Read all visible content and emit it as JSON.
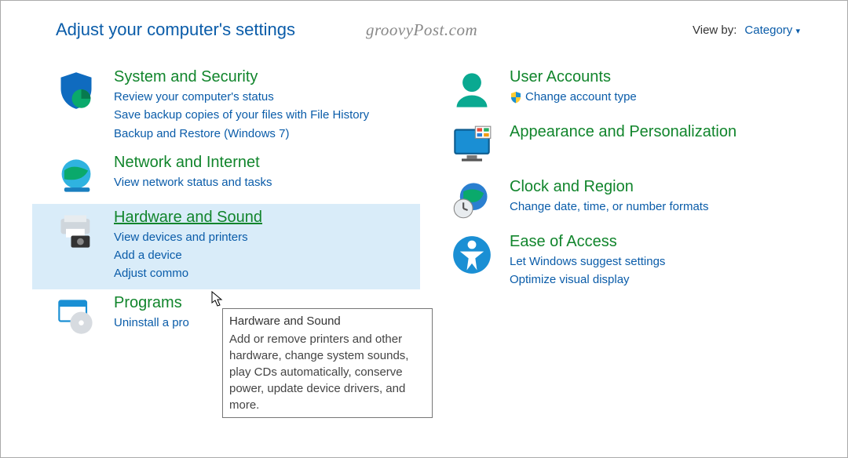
{
  "header": {
    "title": "Adjust your computer's settings",
    "watermark": "groovyPost.com",
    "view_by_label": "View by:",
    "view_by_value": "Category"
  },
  "left": [
    {
      "id": "system-security",
      "title": "System and Security",
      "links": [
        "Review your computer's status",
        "Save backup copies of your files with File History",
        "Backup and Restore (Windows 7)"
      ]
    },
    {
      "id": "network-internet",
      "title": "Network and Internet",
      "links": [
        "View network status and tasks"
      ]
    },
    {
      "id": "hardware-sound",
      "title": "Hardware and Sound",
      "links": [
        "View devices and printers",
        "Add a device",
        "Adjust commo"
      ]
    },
    {
      "id": "programs",
      "title": "Programs",
      "links": [
        "Uninstall a pro"
      ]
    }
  ],
  "right": [
    {
      "id": "user-accounts",
      "title": "User Accounts",
      "links": [
        "Change account type"
      ],
      "shield": true
    },
    {
      "id": "appearance",
      "title": "Appearance and Personalization",
      "links": []
    },
    {
      "id": "clock-region",
      "title": "Clock and Region",
      "links": [
        "Change date, time, or number formats"
      ]
    },
    {
      "id": "ease-access",
      "title": "Ease of Access",
      "links": [
        "Let Windows suggest settings",
        "Optimize visual display"
      ]
    }
  ],
  "tooltip": {
    "title": "Hardware and Sound",
    "body": "Add or remove printers and other hardware, change system sounds, play CDs automatically, conserve power, update device drivers, and more."
  }
}
